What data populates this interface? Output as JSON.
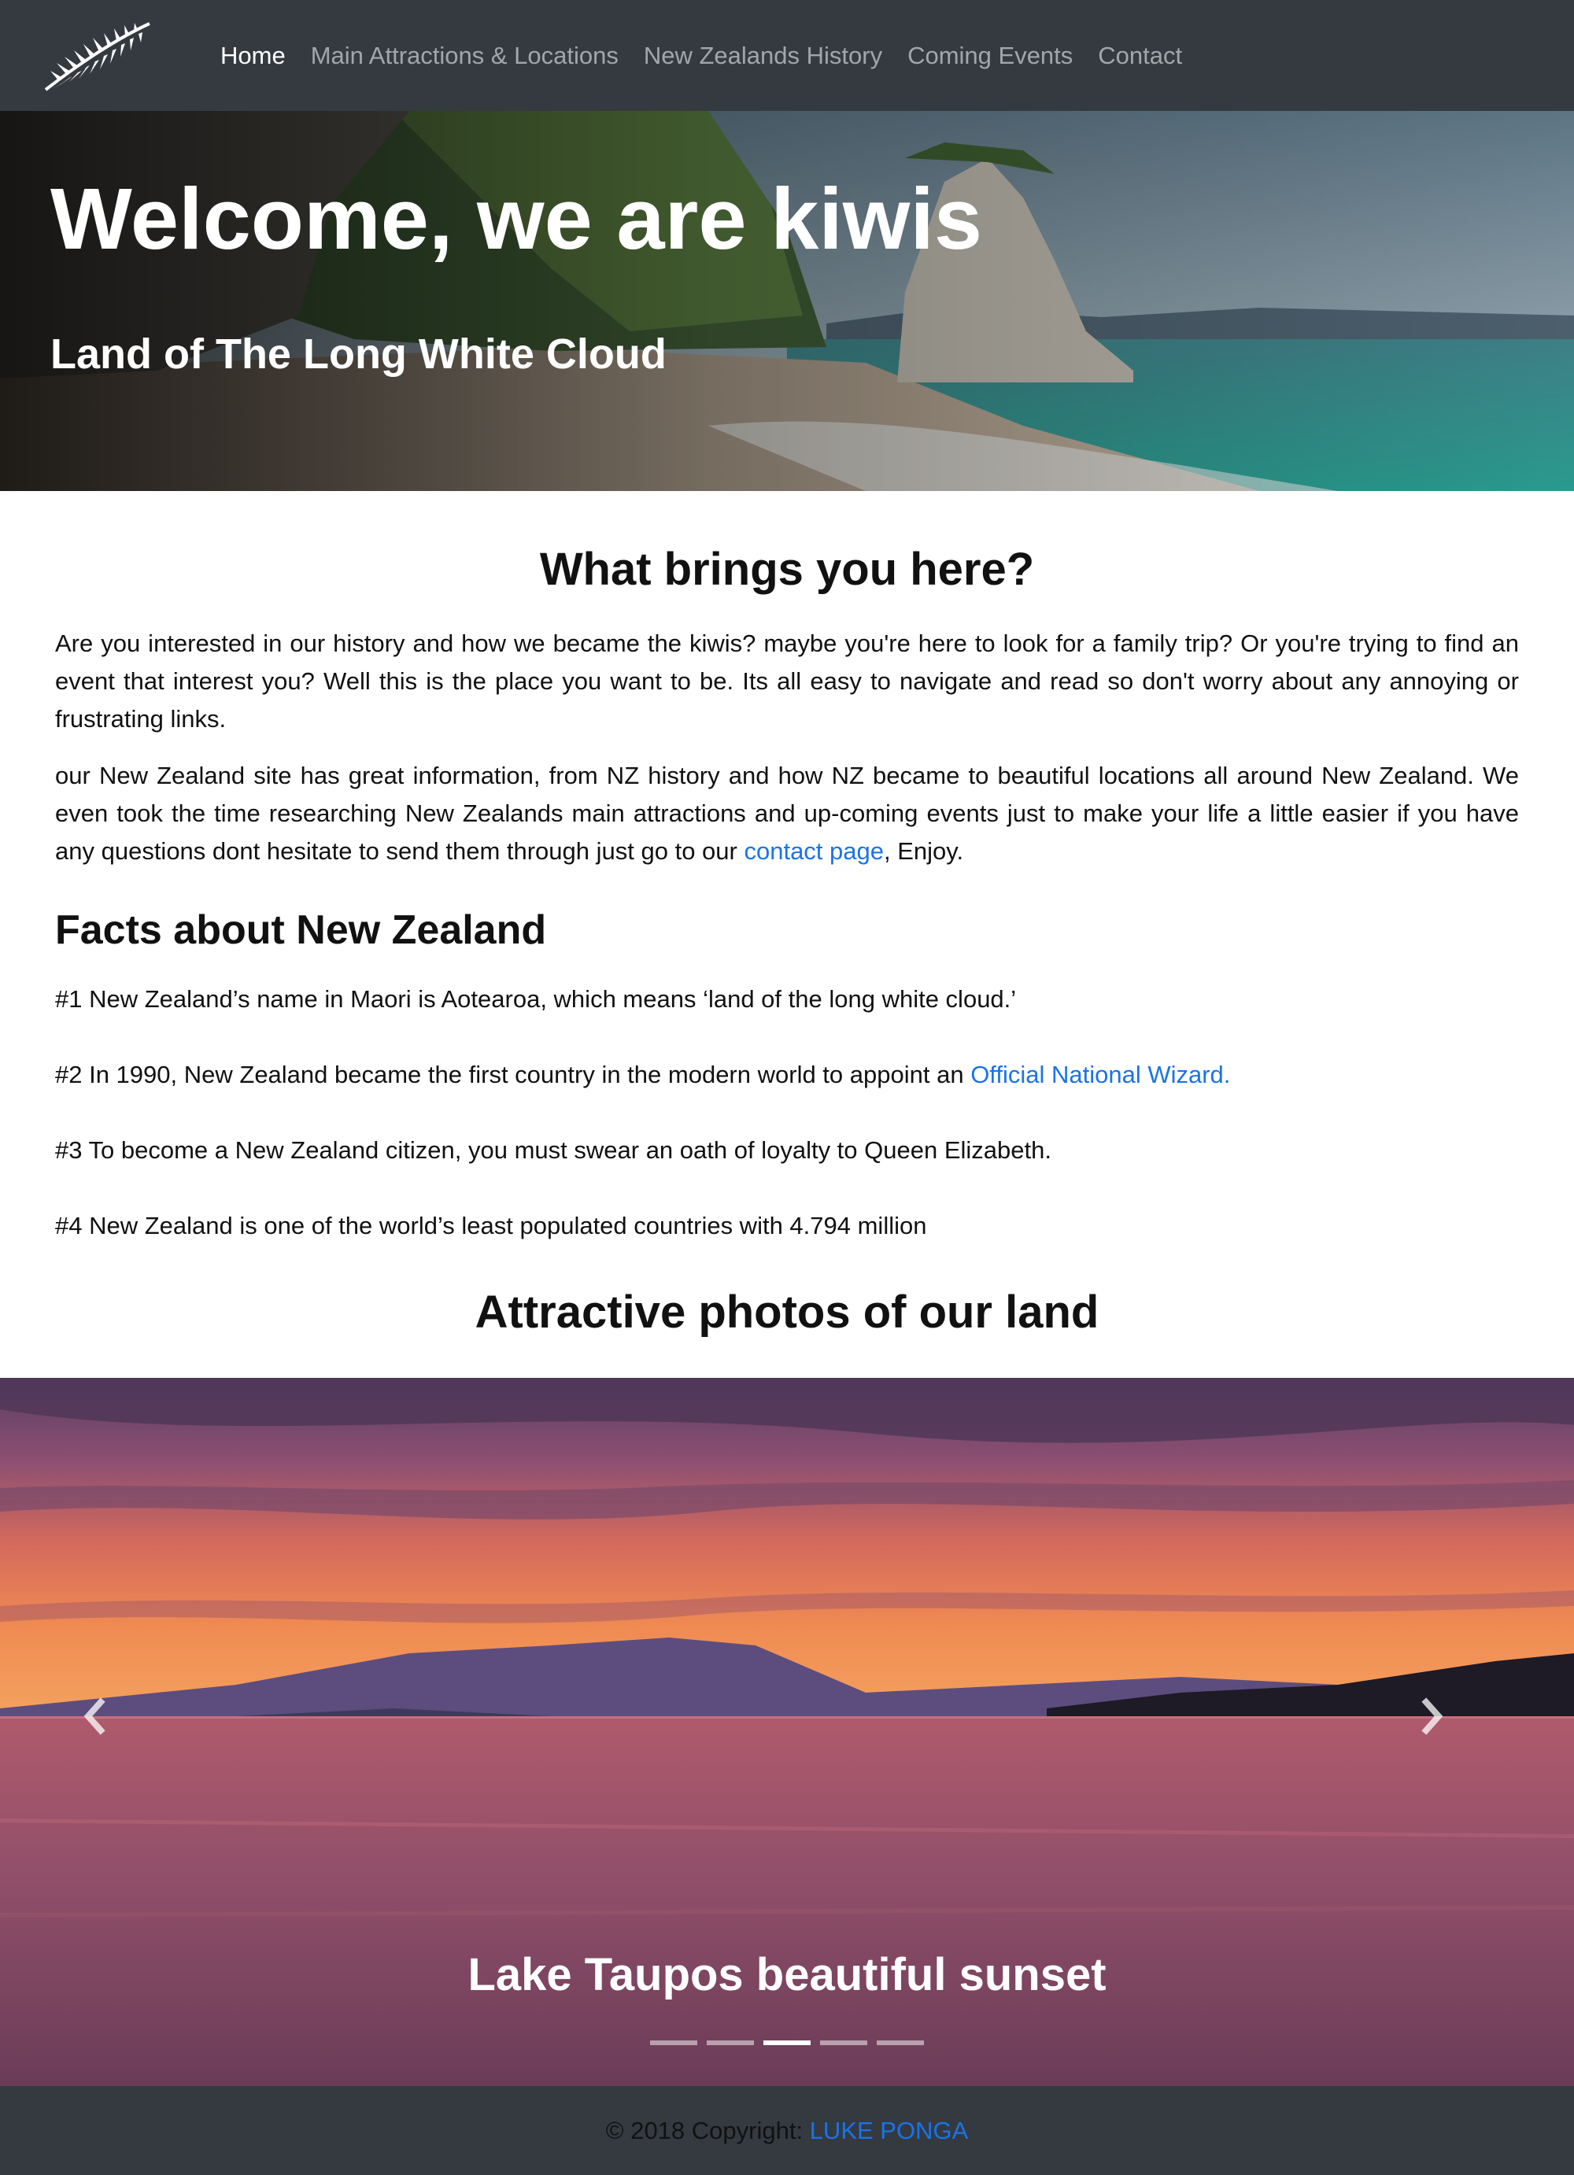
{
  "nav": {
    "links": [
      {
        "label": "Home",
        "active": true
      },
      {
        "label": "Main Attractions & Locations",
        "active": false
      },
      {
        "label": "New Zealands History",
        "active": false
      },
      {
        "label": "Coming Events",
        "active": false
      },
      {
        "label": "Contact",
        "active": false
      }
    ],
    "logo_icon": "silver-fern-icon"
  },
  "hero": {
    "title": "Welcome, we are kiwis",
    "subtitle": "Land of The Long White Cloud"
  },
  "intro": {
    "heading": "What brings you here?",
    "para1": "Are you interested in our history and how we became the kiwis? maybe you're here to look for a family trip? Or you're trying to find an event that interest you? Well this is the place you want to be. Its all easy to navigate and read so don't worry about any annoying or frustrating links.",
    "para2_before": "our New Zealand site has great information, from NZ history and how NZ became to beautiful locations all around New Zealand. We even took the time researching New Zealands main attractions and up-coming events just to make your life a little easier if you have any questions dont hesitate to send them through just go to our ",
    "para2_link": "contact page",
    "para2_after": ", Enjoy."
  },
  "facts": {
    "heading": "Facts about New Zealand",
    "fact1": "#1 New Zealand’s name in Maori is Aotearoa, which means ‘land of the long white cloud.’",
    "fact2_before": "#2 In 1990, New Zealand became the first country in the modern world to appoint an ",
    "fact2_link": "Official National Wizard.",
    "fact3": "#3 To become a New Zealand citizen, you must swear an oath of loyalty to Queen Elizabeth.",
    "fact4": "#4 New Zealand is one of the world’s least populated countries with 4.794 million"
  },
  "photos": {
    "heading": "Attractive photos of our land",
    "caption": "Lake Taupos beautiful sunset",
    "slide_count": 5,
    "active_slide": 3,
    "prev_icon": "chevron-left-icon",
    "next_icon": "chevron-right-icon"
  },
  "footer": {
    "text": "© 2018 Copyright: ",
    "link": "LUKE PONGA"
  },
  "colors": {
    "navbar_bg": "#343a40",
    "link": "#1a73e8",
    "nav_active": "#ffffff",
    "nav_inactive": "rgba(255,255,255,0.55)"
  }
}
